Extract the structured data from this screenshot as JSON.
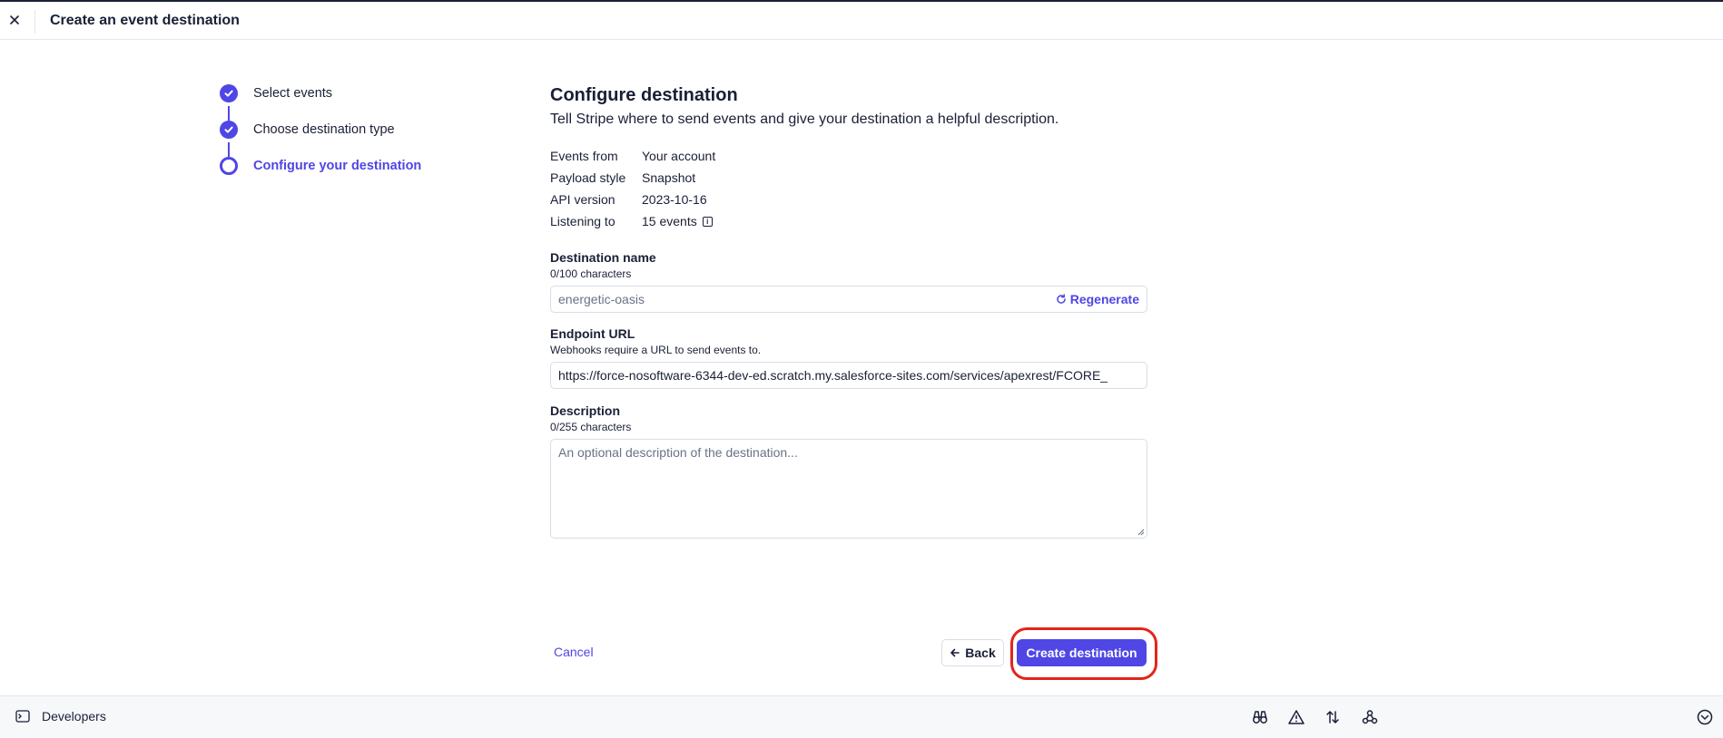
{
  "header": {
    "title": "Create an event destination"
  },
  "stepper": {
    "steps": [
      {
        "label": "Select events",
        "state": "done"
      },
      {
        "label": "Choose destination type",
        "state": "done"
      },
      {
        "label": "Configure your destination",
        "state": "current"
      }
    ]
  },
  "main": {
    "title": "Configure destination",
    "subtitle": "Tell Stripe where to send events and give your destination a helpful description.",
    "info": [
      {
        "key": "Events from",
        "value": "Your account"
      },
      {
        "key": "Payload style",
        "value": "Snapshot"
      },
      {
        "key": "API version",
        "value": "2023-10-16"
      },
      {
        "key": "Listening to",
        "value": "15 events"
      }
    ],
    "name_field": {
      "label": "Destination name",
      "hint": "0/100 characters",
      "placeholder": "energetic-oasis",
      "regenerate_label": "Regenerate"
    },
    "url_field": {
      "label": "Endpoint URL",
      "hint": "Webhooks require a URL to send events to.",
      "value": "https://force-nosoftware-6344-dev-ed.scratch.my.salesforce-sites.com/services/apexrest/FCORE_"
    },
    "description_field": {
      "label": "Description",
      "hint": "0/255 characters",
      "placeholder": "An optional description of the destination..."
    }
  },
  "footer": {
    "cancel_label": "Cancel",
    "back_label": "Back",
    "create_label": "Create destination"
  },
  "bottombar": {
    "label": "Developers",
    "icons": [
      "binoculars-icon",
      "warning-icon",
      "sort-arrows-icon",
      "webhook-icon",
      "chevron-circle-icon"
    ]
  },
  "colors": {
    "accent": "#4f46e5",
    "highlight": "#e3241b",
    "text": "#1a1f36"
  }
}
